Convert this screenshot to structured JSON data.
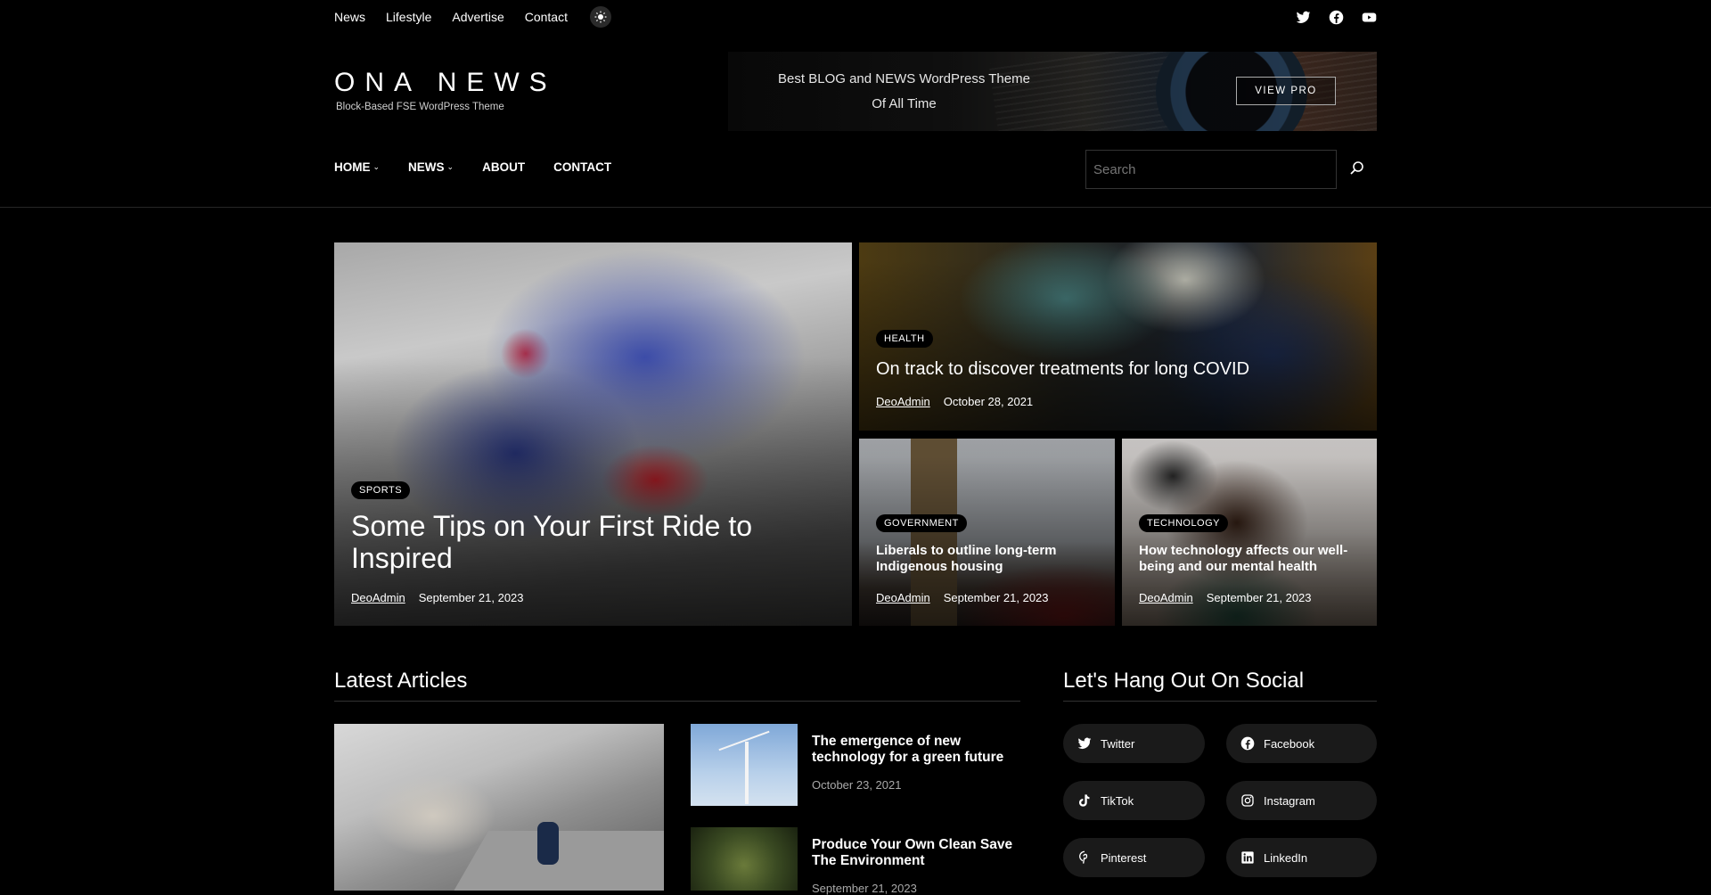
{
  "topnav": [
    "News",
    "Lifestyle",
    "Advertise",
    "Contact"
  ],
  "site": {
    "title": "ONA NEWS",
    "tagline": "Block-Based FSE WordPress Theme"
  },
  "promo": {
    "line1": "Best  BLOG and NEWS WordPress Theme",
    "line2": "Of All Time",
    "button": "VIEW PRO"
  },
  "menu": {
    "home": "HOME",
    "news": "NEWS",
    "about": "ABOUT",
    "contact": "CONTACT"
  },
  "search": {
    "placeholder": "Search"
  },
  "hero": [
    {
      "tag": "SPORTS",
      "title": "Some Tips on Your First Ride to Inspired",
      "author": "DeoAdmin",
      "date": "September 21, 2023"
    },
    {
      "tag": "HEALTH",
      "title": "On track to discover treatments for long COVID",
      "author": "DeoAdmin",
      "date": "October 28, 2021"
    },
    {
      "tag": "GOVERNMENT",
      "title": "Liberals to outline long-term Indigenous housing",
      "author": "DeoAdmin",
      "date": "September 21, 2023"
    },
    {
      "tag": "TECHNOLOGY",
      "title": "How technology affects our well-being and our mental health",
      "author": "DeoAdmin",
      "date": "September 21, 2023"
    }
  ],
  "latest": {
    "heading": "Latest Articles",
    "items": [
      {
        "title": "The emergence of new technology for a green future",
        "date": "October 23, 2021"
      },
      {
        "title": "Produce Your Own Clean Save The Environment",
        "date": "September 21, 2023"
      }
    ]
  },
  "social": {
    "heading": "Let's Hang Out On Social",
    "items": [
      "Twitter",
      "Facebook",
      "TikTok",
      "Instagram",
      "Pinterest",
      "LinkedIn"
    ]
  },
  "colors": {
    "background": "#000000",
    "text": "#ffffff",
    "pill": "#1a1a1a"
  }
}
